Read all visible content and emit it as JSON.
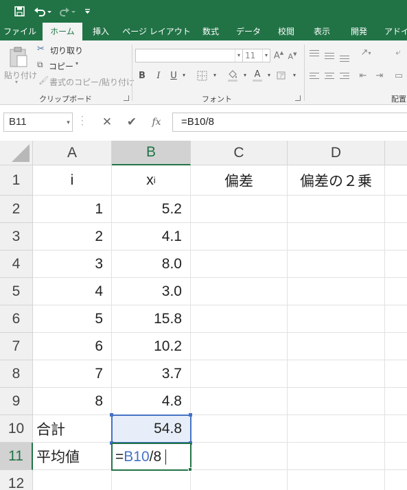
{
  "colors": {
    "accent": "#217346",
    "reference": "#4472c4"
  },
  "quick_access": {
    "icons": [
      "save-icon",
      "undo-icon",
      "redo-icon",
      "customize-qat-icon"
    ]
  },
  "ribbon": {
    "tabs": [
      "ファイル",
      "ホーム",
      "挿入",
      "ページ レイアウト",
      "数式",
      "データ",
      "校閲",
      "表示",
      "開発",
      "アドイ"
    ],
    "active_tab": "ホーム",
    "clipboard": {
      "paste": "貼り付け",
      "cut": "切り取り",
      "copy": "コピー",
      "format_painter": "書式のコピー/貼り付け",
      "label": "クリップボード"
    },
    "font": {
      "label": "フォント",
      "name_value": "",
      "size_value": "11",
      "bold": "B",
      "italic": "I",
      "underline": "U",
      "grow": "A",
      "shrink": "A",
      "font_color": "A"
    },
    "alignment": {
      "label": "配置"
    }
  },
  "formula_bar": {
    "name_box": "B11",
    "cancel": "✕",
    "enter": "✔",
    "fx": "fx",
    "formula": "=B10/8"
  },
  "sheet": {
    "columns": [
      "A",
      "B",
      "C",
      "D"
    ],
    "rows": [
      "1",
      "2",
      "3",
      "4",
      "5",
      "6",
      "7",
      "8",
      "9",
      "10",
      "11",
      "12"
    ],
    "headers": {
      "a1": "i",
      "b1_base": "x",
      "b1_sub": "i",
      "c1": "偏差",
      "d1": "偏差の２乗"
    },
    "i_values": [
      "1",
      "2",
      "3",
      "4",
      "5",
      "6",
      "7",
      "8"
    ],
    "x_values": [
      "5.2",
      "4.1",
      "8.0",
      "3.0",
      "15.8",
      "10.2",
      "3.7",
      "4.8"
    ],
    "total_label": "合計",
    "total_value": "54.8",
    "mean_label": "平均値",
    "editing": {
      "prefix": "=",
      "ref": "B10",
      "suffix": "/8"
    }
  }
}
